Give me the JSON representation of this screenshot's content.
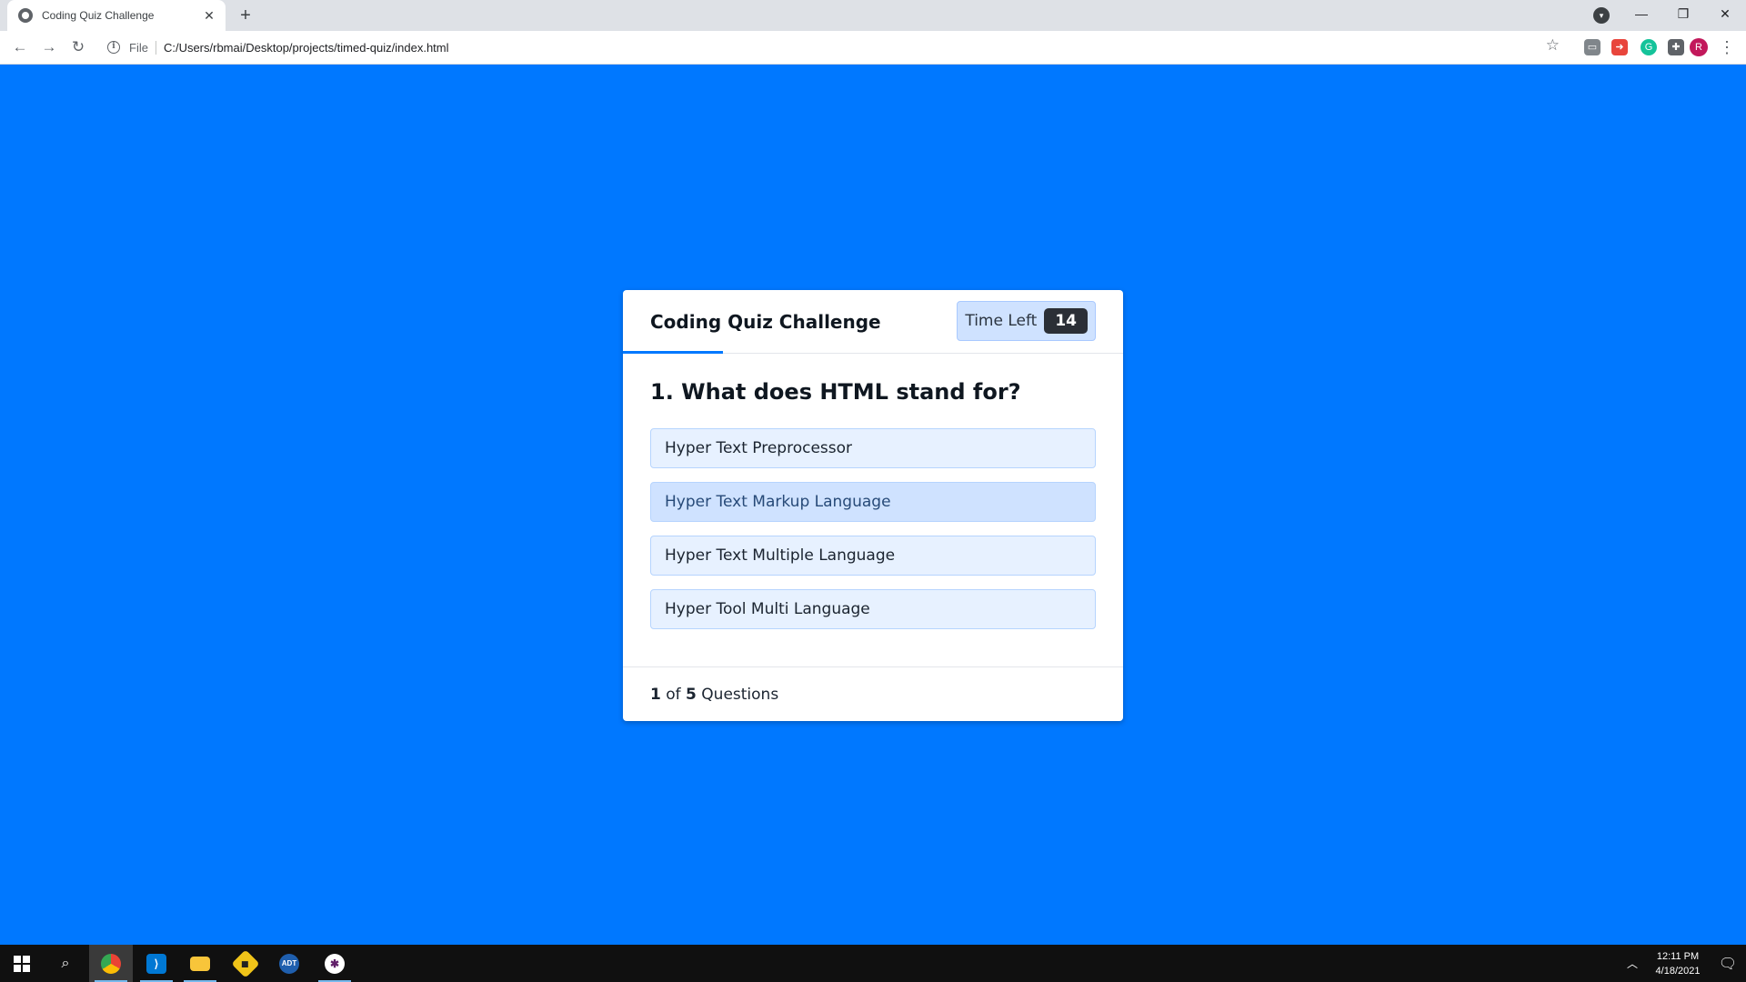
{
  "browser": {
    "tab_title": "Coding Quiz Challenge",
    "tab_close": "✕",
    "new_tab": "+",
    "scheme": "File",
    "url": "C:/Users/rbmai/Desktop/projects/timed-quiz/index.html",
    "profile_initial": "R",
    "icons": [
      "globe-icon",
      "close-icon",
      "plus-icon",
      "back-icon",
      "forward-icon",
      "reload-icon",
      "info-icon",
      "star-icon",
      "cast-icon",
      "extension-icon",
      "grammarly-icon",
      "puzzle-icon",
      "avatar",
      "more-icon"
    ]
  },
  "quiz": {
    "title": "Coding Quiz Challenge",
    "timer_label": "Time Left",
    "timer_value": "14",
    "question": "1. What does HTML stand for?",
    "answers": [
      "Hyper Text Preprocessor",
      "Hyper Text Markup Language",
      "Hyper Text Multiple Language",
      "Hyper Tool Multi Language"
    ],
    "footer": {
      "current": "1",
      "of": " of ",
      "total": "5",
      "suffix": " Questions"
    },
    "progress_fraction": 0.2
  },
  "taskbar": {
    "apps": [
      "windows-start-icon",
      "search-icon",
      "chrome-icon",
      "vscode-icon",
      "file-explorer-icon",
      "git-icon",
      "adt-icon",
      "slack-icon"
    ],
    "time": "12:11 PM",
    "date": "4/18/2021"
  },
  "colors": {
    "page_background": "#0078ff",
    "answer_background": "#e7f1ff",
    "answer_hover": "#cfe2ff",
    "timer_badge": "#2b2f36"
  }
}
